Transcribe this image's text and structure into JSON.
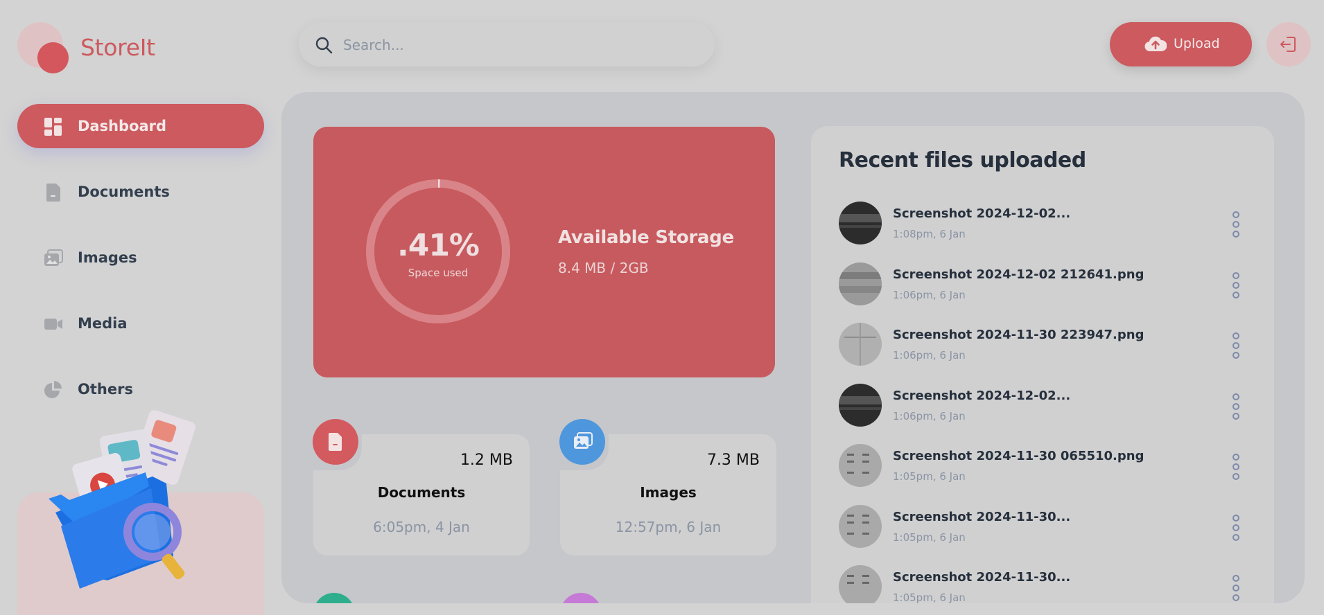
{
  "app": {
    "name": "StoreIt"
  },
  "sidebar": {
    "items": [
      {
        "label": "Dashboard",
        "icon": "dashboard-icon",
        "active": true
      },
      {
        "label": "Documents",
        "icon": "document-icon",
        "active": false
      },
      {
        "label": "Images",
        "icon": "images-icon",
        "active": false
      },
      {
        "label": "Media",
        "icon": "video-icon",
        "active": false
      },
      {
        "label": "Others",
        "icon": "pie-chart-icon",
        "active": false
      }
    ]
  },
  "header": {
    "search_placeholder": "Search...",
    "upload_label": "Upload",
    "icons": {
      "search": "search-icon",
      "upload": "cloud-upload-icon",
      "logout": "logout-icon"
    }
  },
  "storage": {
    "percent_label": ".41%",
    "percent_used": 0.41,
    "space_used_label": "Space used",
    "title": "Available Storage",
    "usage": "8.4 MB / 2GB"
  },
  "categories": [
    {
      "name": "Documents",
      "size": "1.2 MB",
      "date": "6:05pm, 4 Jan",
      "icon": "document-icon",
      "color": "#d35a5e"
    },
    {
      "name": "Images",
      "size": "7.3 MB",
      "date": "12:57pm, 6 Jan",
      "icon": "image-icon",
      "color": "#4e97dc"
    }
  ],
  "recent": {
    "title": "Recent files uploaded",
    "files": [
      {
        "name": "Screenshot 2024-12-02...",
        "date": "1:08pm, 6 Jan"
      },
      {
        "name": "Screenshot 2024-12-02 212641.png",
        "date": "1:06pm, 6 Jan"
      },
      {
        "name": "Screenshot 2024-11-30 223947.png",
        "date": "1:06pm, 6 Jan"
      },
      {
        "name": "Screenshot 2024-12-02...",
        "date": "1:06pm, 6 Jan"
      },
      {
        "name": "Screenshot 2024-11-30 065510.png",
        "date": "1:05pm, 6 Jan"
      },
      {
        "name": "Screenshot 2024-11-30...",
        "date": "1:05pm, 6 Jan"
      },
      {
        "name": "Screenshot 2024-11-30...",
        "date": "1:05pm, 6 Jan"
      }
    ]
  },
  "colors": {
    "brand": "#cc5a5f",
    "background": "#d3d3d3",
    "panel": "#c6c7cb",
    "card": "#d0d0d1",
    "text": "#333f4e",
    "muted": "#8a94a3"
  }
}
